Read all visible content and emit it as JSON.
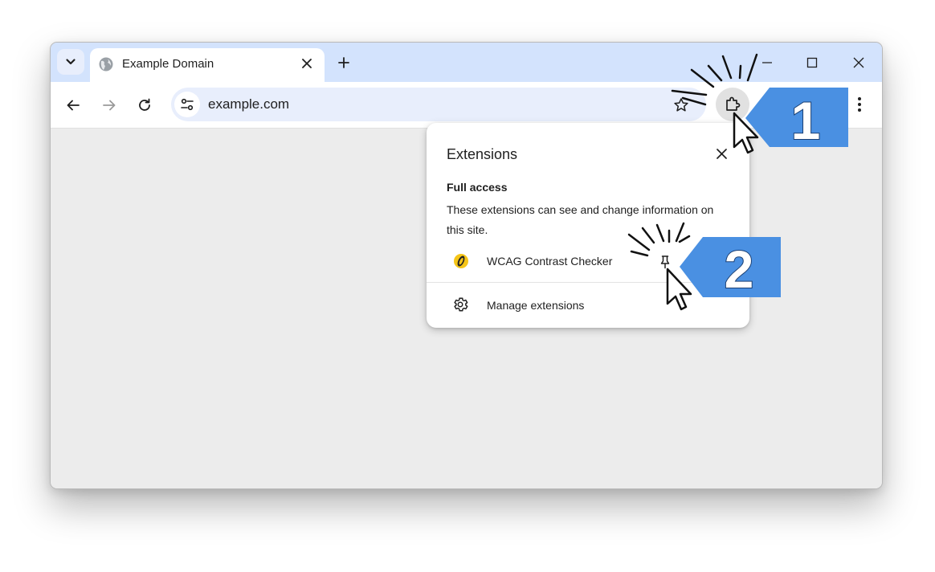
{
  "browser": {
    "tab": {
      "title": "Example Domain",
      "icon": "globe-icon"
    },
    "address_bar": {
      "url": "example.com"
    },
    "icons": {
      "tab_search": "chevron-down-icon",
      "close_tab": "close-icon",
      "new_tab": "plus-icon",
      "minimize": "minimize-icon",
      "maximize": "maximize-icon",
      "close_window": "close-icon",
      "back": "arrow-left-icon",
      "forward": "arrow-right-icon",
      "reload": "reload-icon",
      "site_info": "tune-icon",
      "bookmark": "star-icon",
      "extensions": "puzzle-icon",
      "menu": "kebab-menu-icon"
    }
  },
  "extensions_popup": {
    "title": "Extensions",
    "section_heading": "Full access",
    "section_description": "These extensions can see and change information on this site.",
    "extensions": [
      {
        "name": "WCAG Contrast Checker",
        "icon": "wcag-logo-icon",
        "action_icon": "pin-icon"
      }
    ],
    "manage_label": "Manage extensions",
    "manage_icon": "gear-icon"
  },
  "annotations": {
    "step_1": "1",
    "step_2": "2",
    "badge_color": "#4a90e2"
  },
  "colors": {
    "tab_strip": "#d3e3fd",
    "omnibox": "#e8eefc",
    "content": "#ececec",
    "text": "#1f1f1f"
  }
}
